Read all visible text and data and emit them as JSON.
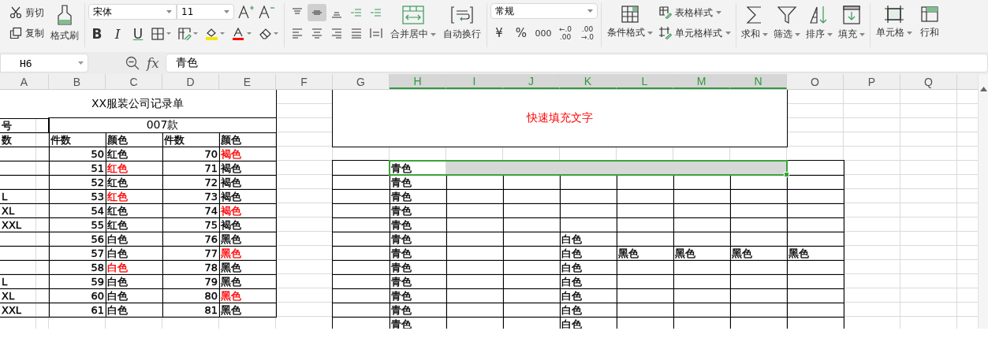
{
  "toolbar": {
    "clipboard": {
      "cut": "剪切",
      "copy": "复制",
      "painter": "格式刷"
    },
    "font": {
      "name": "宋体",
      "size": "11",
      "styles": [
        "B",
        "I",
        "U"
      ]
    },
    "alignment": {
      "buttons": [
        {
          "selected": false
        },
        {
          "selected": true
        },
        {
          "selected": false
        },
        {
          "selected": false
        },
        {
          "selected": false
        },
        {
          "selected": false
        },
        {
          "selected": false
        },
        {
          "selected": false
        },
        {
          "selected": false
        },
        {
          "selected": false
        }
      ],
      "merge": "合并居中",
      "wrap": "自动换行"
    },
    "number": {
      "format": "常规",
      "symbols": [
        "¥",
        "%",
        "000"
      ],
      "decimals": [
        {
          "top": "←.0",
          "bottom": ".00"
        },
        {
          "top": ".00",
          "bottom": "→.0"
        }
      ]
    },
    "styles": {
      "conditional": "条件格式",
      "table_style": "表格样式",
      "cell_style": "单元格样式"
    },
    "editing": [
      "求和",
      "筛选",
      "排序",
      "填充"
    ],
    "cells_group": [
      "单元格",
      "行和"
    ]
  },
  "formula_bar": {
    "name_box": "H6",
    "fx": "fx",
    "formula": "青色"
  },
  "sheet": {
    "columns": [
      {
        "label": "A",
        "selected": false
      },
      {
        "label": "B",
        "selected": false
      },
      {
        "label": "C",
        "selected": false
      },
      {
        "label": "D",
        "selected": false
      },
      {
        "label": "E",
        "selected": false
      },
      {
        "label": "F",
        "selected": false
      },
      {
        "label": "G",
        "selected": false
      },
      {
        "label": "H",
        "selected": true
      },
      {
        "label": "I",
        "selected": true
      },
      {
        "label": "J",
        "selected": true
      },
      {
        "label": "K",
        "selected": true
      },
      {
        "label": "L",
        "selected": true
      },
      {
        "label": "M",
        "selected": true
      },
      {
        "label": "N",
        "selected": true
      },
      {
        "label": "O",
        "selected": false
      },
      {
        "label": "P",
        "selected": false
      },
      {
        "label": "Q",
        "selected": false
      }
    ],
    "tables": {
      "A1:E16": {
        "kind": "grid"
      },
      "G6:O17": {
        "kind": "grid"
      }
    },
    "merges": {
      "A1:E2": {
        "text": "XX服装公司记录单"
      },
      "B3:E3": {
        "text": "007款"
      },
      "G1:N4": {
        "text": "快速填充文字",
        "color": "#ff0000"
      }
    },
    "cells": {
      "A3": {
        "kind": "text",
        "text": "号"
      },
      "A4": {
        "kind": "text",
        "text": "数"
      },
      "B4": {
        "kind": "text",
        "text": "件数"
      },
      "C4": {
        "kind": "text",
        "text": "颜色"
      },
      "D4": {
        "kind": "text",
        "text": "件数"
      },
      "E4": {
        "kind": "text",
        "text": "颜色"
      },
      "B5": {
        "kind": "number",
        "text": "50"
      },
      "C5": {
        "kind": "text",
        "text": "红色"
      },
      "D5": {
        "kind": "number",
        "text": "70"
      },
      "E5": {
        "kind": "text",
        "text": "褐色",
        "color": "#ff0000"
      },
      "B6": {
        "kind": "number",
        "text": "51"
      },
      "C6": {
        "kind": "text",
        "text": "红色",
        "color": "#ff0000"
      },
      "D6": {
        "kind": "number",
        "text": "71"
      },
      "E6": {
        "kind": "text",
        "text": "褐色"
      },
      "H6": {
        "kind": "text",
        "text": "青色",
        "selected": true
      },
      "I6": {
        "selected": true
      },
      "J6": {
        "selected": true
      },
      "K6": {
        "selected": true
      },
      "L6": {
        "selected": true
      },
      "M6": {
        "selected": true
      },
      "N6": {
        "selected": true
      },
      "B7": {
        "kind": "number",
        "text": "52"
      },
      "C7": {
        "kind": "text",
        "text": "红色"
      },
      "D7": {
        "kind": "number",
        "text": "72"
      },
      "E7": {
        "kind": "text",
        "text": "褐色"
      },
      "H7": {
        "kind": "text",
        "text": "青色"
      },
      "A8": {
        "kind": "text",
        "text": "L"
      },
      "B8": {
        "kind": "number",
        "text": "53"
      },
      "C8": {
        "kind": "text",
        "text": "红色",
        "color": "#ff0000"
      },
      "D8": {
        "kind": "number",
        "text": "73"
      },
      "E8": {
        "kind": "text",
        "text": "褐色"
      },
      "H8": {
        "kind": "text",
        "text": "青色"
      },
      "A9": {
        "kind": "text",
        "text": "XL"
      },
      "B9": {
        "kind": "number",
        "text": "54"
      },
      "C9": {
        "kind": "text",
        "text": "红色"
      },
      "D9": {
        "kind": "number",
        "text": "74"
      },
      "E9": {
        "kind": "text",
        "text": "褐色",
        "color": "#ff0000"
      },
      "H9": {
        "kind": "text",
        "text": "青色"
      },
      "A10": {
        "kind": "text",
        "text": "XXL"
      },
      "B10": {
        "kind": "number",
        "text": "55"
      },
      "C10": {
        "kind": "text",
        "text": "红色"
      },
      "D10": {
        "kind": "number",
        "text": "75"
      },
      "E10": {
        "kind": "text",
        "text": "褐色"
      },
      "H10": {
        "kind": "text",
        "text": "青色"
      },
      "B11": {
        "kind": "number",
        "text": "56"
      },
      "C11": {
        "kind": "text",
        "text": "白色"
      },
      "D11": {
        "kind": "number",
        "text": "76"
      },
      "E11": {
        "kind": "text",
        "text": "黑色"
      },
      "H11": {
        "kind": "text",
        "text": "青色"
      },
      "K11": {
        "kind": "text",
        "text": "白色"
      },
      "B12": {
        "kind": "number",
        "text": "57"
      },
      "C12": {
        "kind": "text",
        "text": "白色"
      },
      "D12": {
        "kind": "number",
        "text": "77"
      },
      "E12": {
        "kind": "text",
        "text": "黑色",
        "color": "#ff0000"
      },
      "H12": {
        "kind": "text",
        "text": "青色"
      },
      "K12": {
        "kind": "text",
        "text": "白色"
      },
      "L12": {
        "kind": "text",
        "text": "黑色"
      },
      "M12": {
        "kind": "text",
        "text": "黑色"
      },
      "N12": {
        "kind": "text",
        "text": "黑色"
      },
      "O12": {
        "kind": "text",
        "text": "黑色"
      },
      "B13": {
        "kind": "number",
        "text": "58"
      },
      "C13": {
        "kind": "text",
        "text": "白色",
        "color": "#ff0000"
      },
      "D13": {
        "kind": "number",
        "text": "78"
      },
      "E13": {
        "kind": "text",
        "text": "黑色"
      },
      "H13": {
        "kind": "text",
        "text": "青色"
      },
      "K13": {
        "kind": "text",
        "text": "白色"
      },
      "A14": {
        "kind": "text",
        "text": "L"
      },
      "B14": {
        "kind": "number",
        "text": "59"
      },
      "C14": {
        "kind": "text",
        "text": "白色"
      },
      "D14": {
        "kind": "number",
        "text": "79"
      },
      "E14": {
        "kind": "text",
        "text": "黑色"
      },
      "H14": {
        "kind": "text",
        "text": "青色"
      },
      "K14": {
        "kind": "text",
        "text": "白色"
      },
      "A15": {
        "kind": "text",
        "text": "XL"
      },
      "B15": {
        "kind": "number",
        "text": "60"
      },
      "C15": {
        "kind": "text",
        "text": "白色"
      },
      "D15": {
        "kind": "number",
        "text": "80"
      },
      "E15": {
        "kind": "text",
        "text": "黑色",
        "color": "#ff0000"
      },
      "H15": {
        "kind": "text",
        "text": "青色"
      },
      "K15": {
        "kind": "text",
        "text": "白色"
      },
      "A16": {
        "kind": "text",
        "text": "XXL"
      },
      "B16": {
        "kind": "number",
        "text": "61"
      },
      "C16": {
        "kind": "text",
        "text": "白色"
      },
      "D16": {
        "kind": "number",
        "text": "81"
      },
      "E16": {
        "kind": "text",
        "text": "黑色"
      },
      "H16": {
        "kind": "text",
        "text": "青色"
      },
      "K16": {
        "kind": "text",
        "text": "白色"
      },
      "H17": {
        "kind": "text",
        "text": "青色"
      },
      "K17": {
        "kind": "text",
        "text": "白色"
      }
    }
  }
}
